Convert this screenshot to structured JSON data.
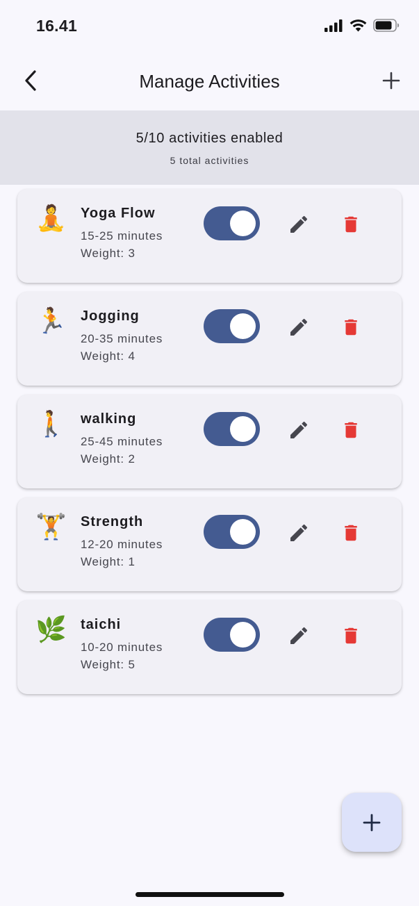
{
  "status_bar": {
    "time": "16.41",
    "icons": [
      "cellular-signal-icon",
      "wifi-icon",
      "battery-icon"
    ]
  },
  "app_bar": {
    "title": "Manage Activities",
    "back_icon": "chevron-left-icon",
    "add_icon": "plus-icon"
  },
  "summary": {
    "enabled_text": "5/10 activities enabled",
    "total_text": "5 total activities"
  },
  "activities": [
    {
      "emoji": "🧘",
      "name": "Yoga Flow",
      "duration": "15-25 minutes",
      "weight": "Weight: 3",
      "enabled": true
    },
    {
      "emoji": "🏃",
      "name": "Jogging",
      "duration": "20-35 minutes",
      "weight": "Weight: 4",
      "enabled": true
    },
    {
      "emoji": "🚶",
      "name": "walking",
      "duration": "25-45 minutes",
      "weight": "Weight: 2",
      "enabled": true
    },
    {
      "emoji": "🏋️",
      "name": "Strength",
      "duration": "12-20 minutes",
      "weight": "Weight: 1",
      "enabled": true
    },
    {
      "emoji": "🌿",
      "name": "taichi",
      "duration": "10-20 minutes",
      "weight": "Weight: 5",
      "enabled": true
    }
  ],
  "colors": {
    "toggle_on": "#445b91",
    "delete": "#e53935",
    "edit": "#46464e",
    "fab_bg": "#dde2fa",
    "summary_bg": "#e2e2ea"
  },
  "fab": {
    "icon": "plus-icon"
  }
}
